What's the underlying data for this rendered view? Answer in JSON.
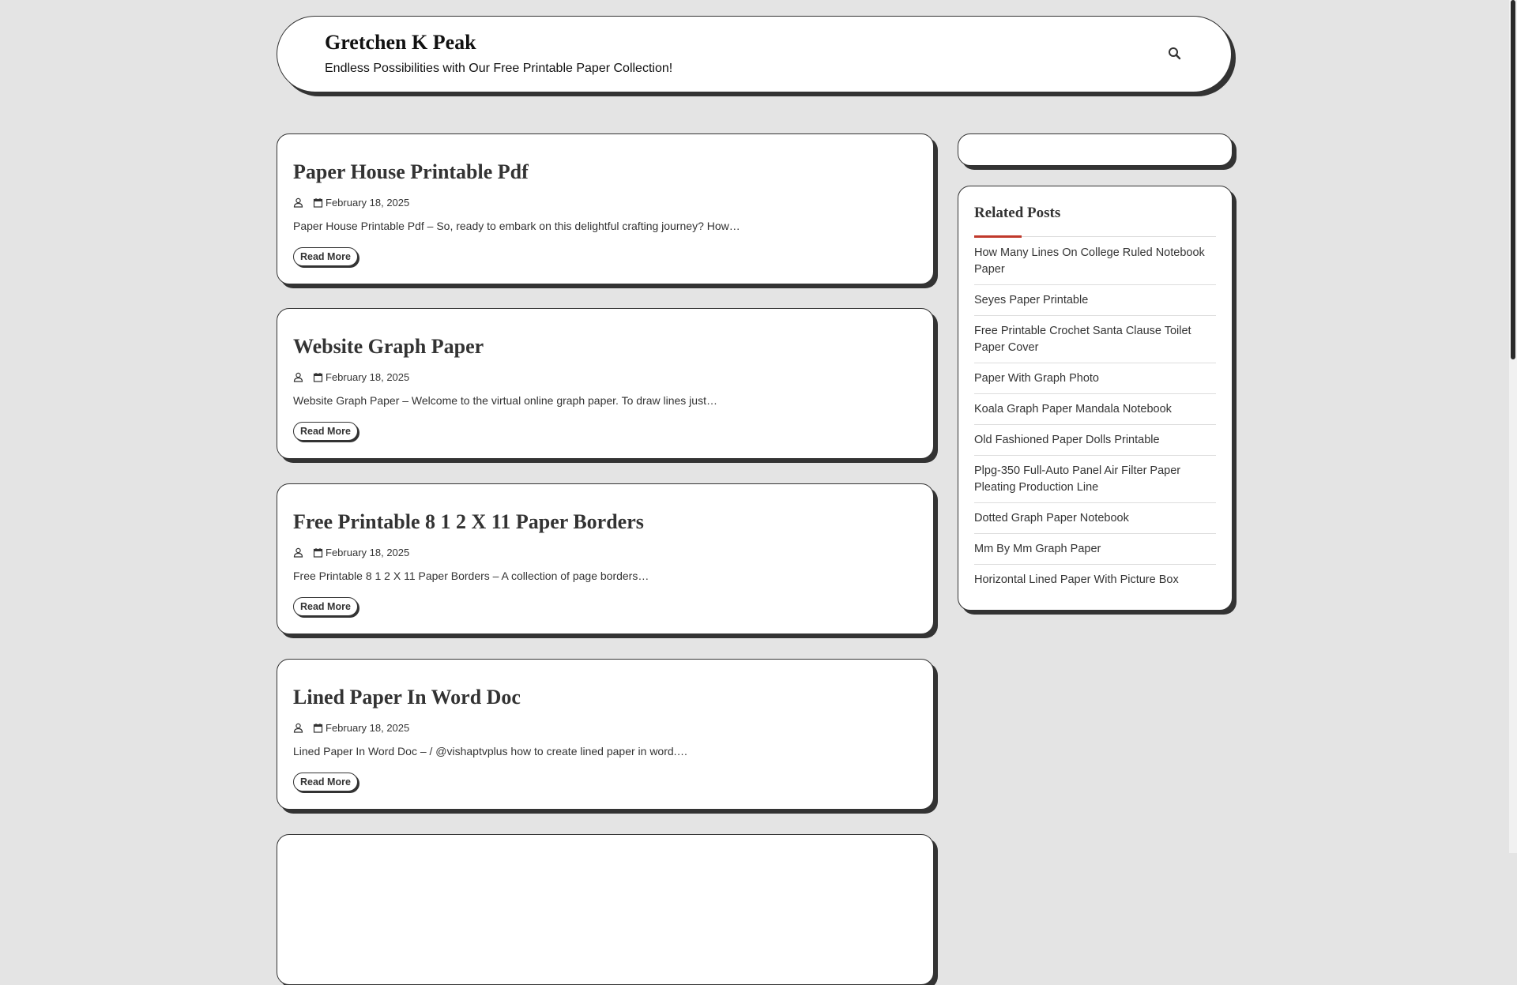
{
  "header": {
    "site_title": "Gretchen K Peak",
    "tagline": "Endless Possibilities with Our Free Printable Paper Collection!",
    "search_icon": "search-icon"
  },
  "posts": [
    {
      "title": "Paper House Printable Pdf",
      "date": "February 18, 2025",
      "excerpt": "Paper House Printable Pdf – So, ready to embark on this delightful crafting journey? How…",
      "read_more": "Read More"
    },
    {
      "title": "Website Graph Paper",
      "date": "February 18, 2025",
      "excerpt": "Website Graph Paper – Welcome to the virtual online graph paper. To draw lines just…",
      "read_more": "Read More"
    },
    {
      "title": "Free Printable 8 1 2 X 11 Paper Borders",
      "date": "February 18, 2025",
      "excerpt": "Free Printable 8 1 2 X 11 Paper Borders – A collection of page borders…",
      "read_more": "Read More"
    },
    {
      "title": "Lined Paper In Word Doc",
      "date": "February 18, 2025",
      "excerpt": "Lined Paper In Word Doc – / @vishaptvplus how to create lined paper in word.…",
      "read_more": "Read More"
    }
  ],
  "sidebar": {
    "related_title": "Related Posts",
    "accent_color": "#c0392b",
    "related": [
      "How Many Lines On College Ruled Notebook Paper",
      "Seyes Paper Printable",
      "Free Printable Crochet Santa Clause Toilet Paper Cover",
      "Paper With Graph Photo",
      "Koala Graph Paper Mandala Notebook",
      "Old Fashioned Paper Dolls Printable",
      "Plpg-350 Full-Auto Panel Air Filter Paper Pleating Production Line",
      "Dotted Graph Paper Notebook",
      "Mm By Mm Graph Paper",
      "Horizontal Lined Paper With Picture Box"
    ]
  }
}
